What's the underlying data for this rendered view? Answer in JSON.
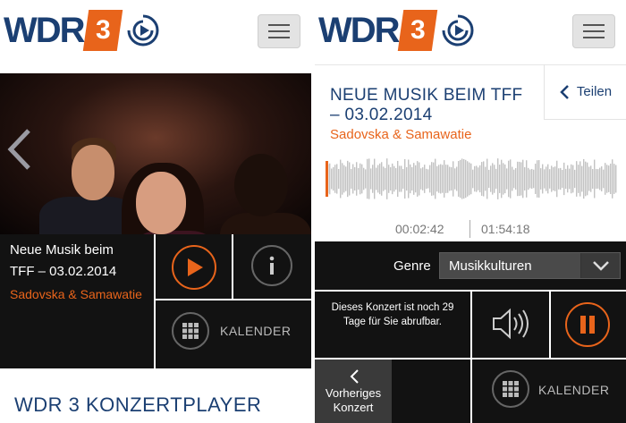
{
  "brand": {
    "logo_text": "WDR",
    "logo_number": "3",
    "accent": "#e8641b",
    "navy": "#1b3f72"
  },
  "left": {
    "menu_icon": "hamburger-menu-icon",
    "prev_icon": "chevron-left-icon",
    "info": {
      "title_line1": "Neue Musik beim",
      "title_line2": "TFF – 03.02.2014",
      "subtitle": "Sadovska & Samawatie"
    },
    "calendar_label": "KALENDER",
    "page_title": "WDR 3 KONZERTPLAYER"
  },
  "right": {
    "track": {
      "title": "NEUE MUSIK BEIM TFF – 03.02.2014",
      "subtitle": "Sadovska & Samawatie"
    },
    "share_label": "Teilen",
    "time_elapsed": "00:02:42",
    "time_total": "01:54:18",
    "genre": {
      "label": "Genre",
      "selected": "Musikkulturen"
    },
    "availability": "Dieses Konzert ist noch 29 Tage für Sie abrufbar.",
    "prev_concert_label": "Vorheriges Konzert",
    "calendar_label": "KALENDER"
  }
}
